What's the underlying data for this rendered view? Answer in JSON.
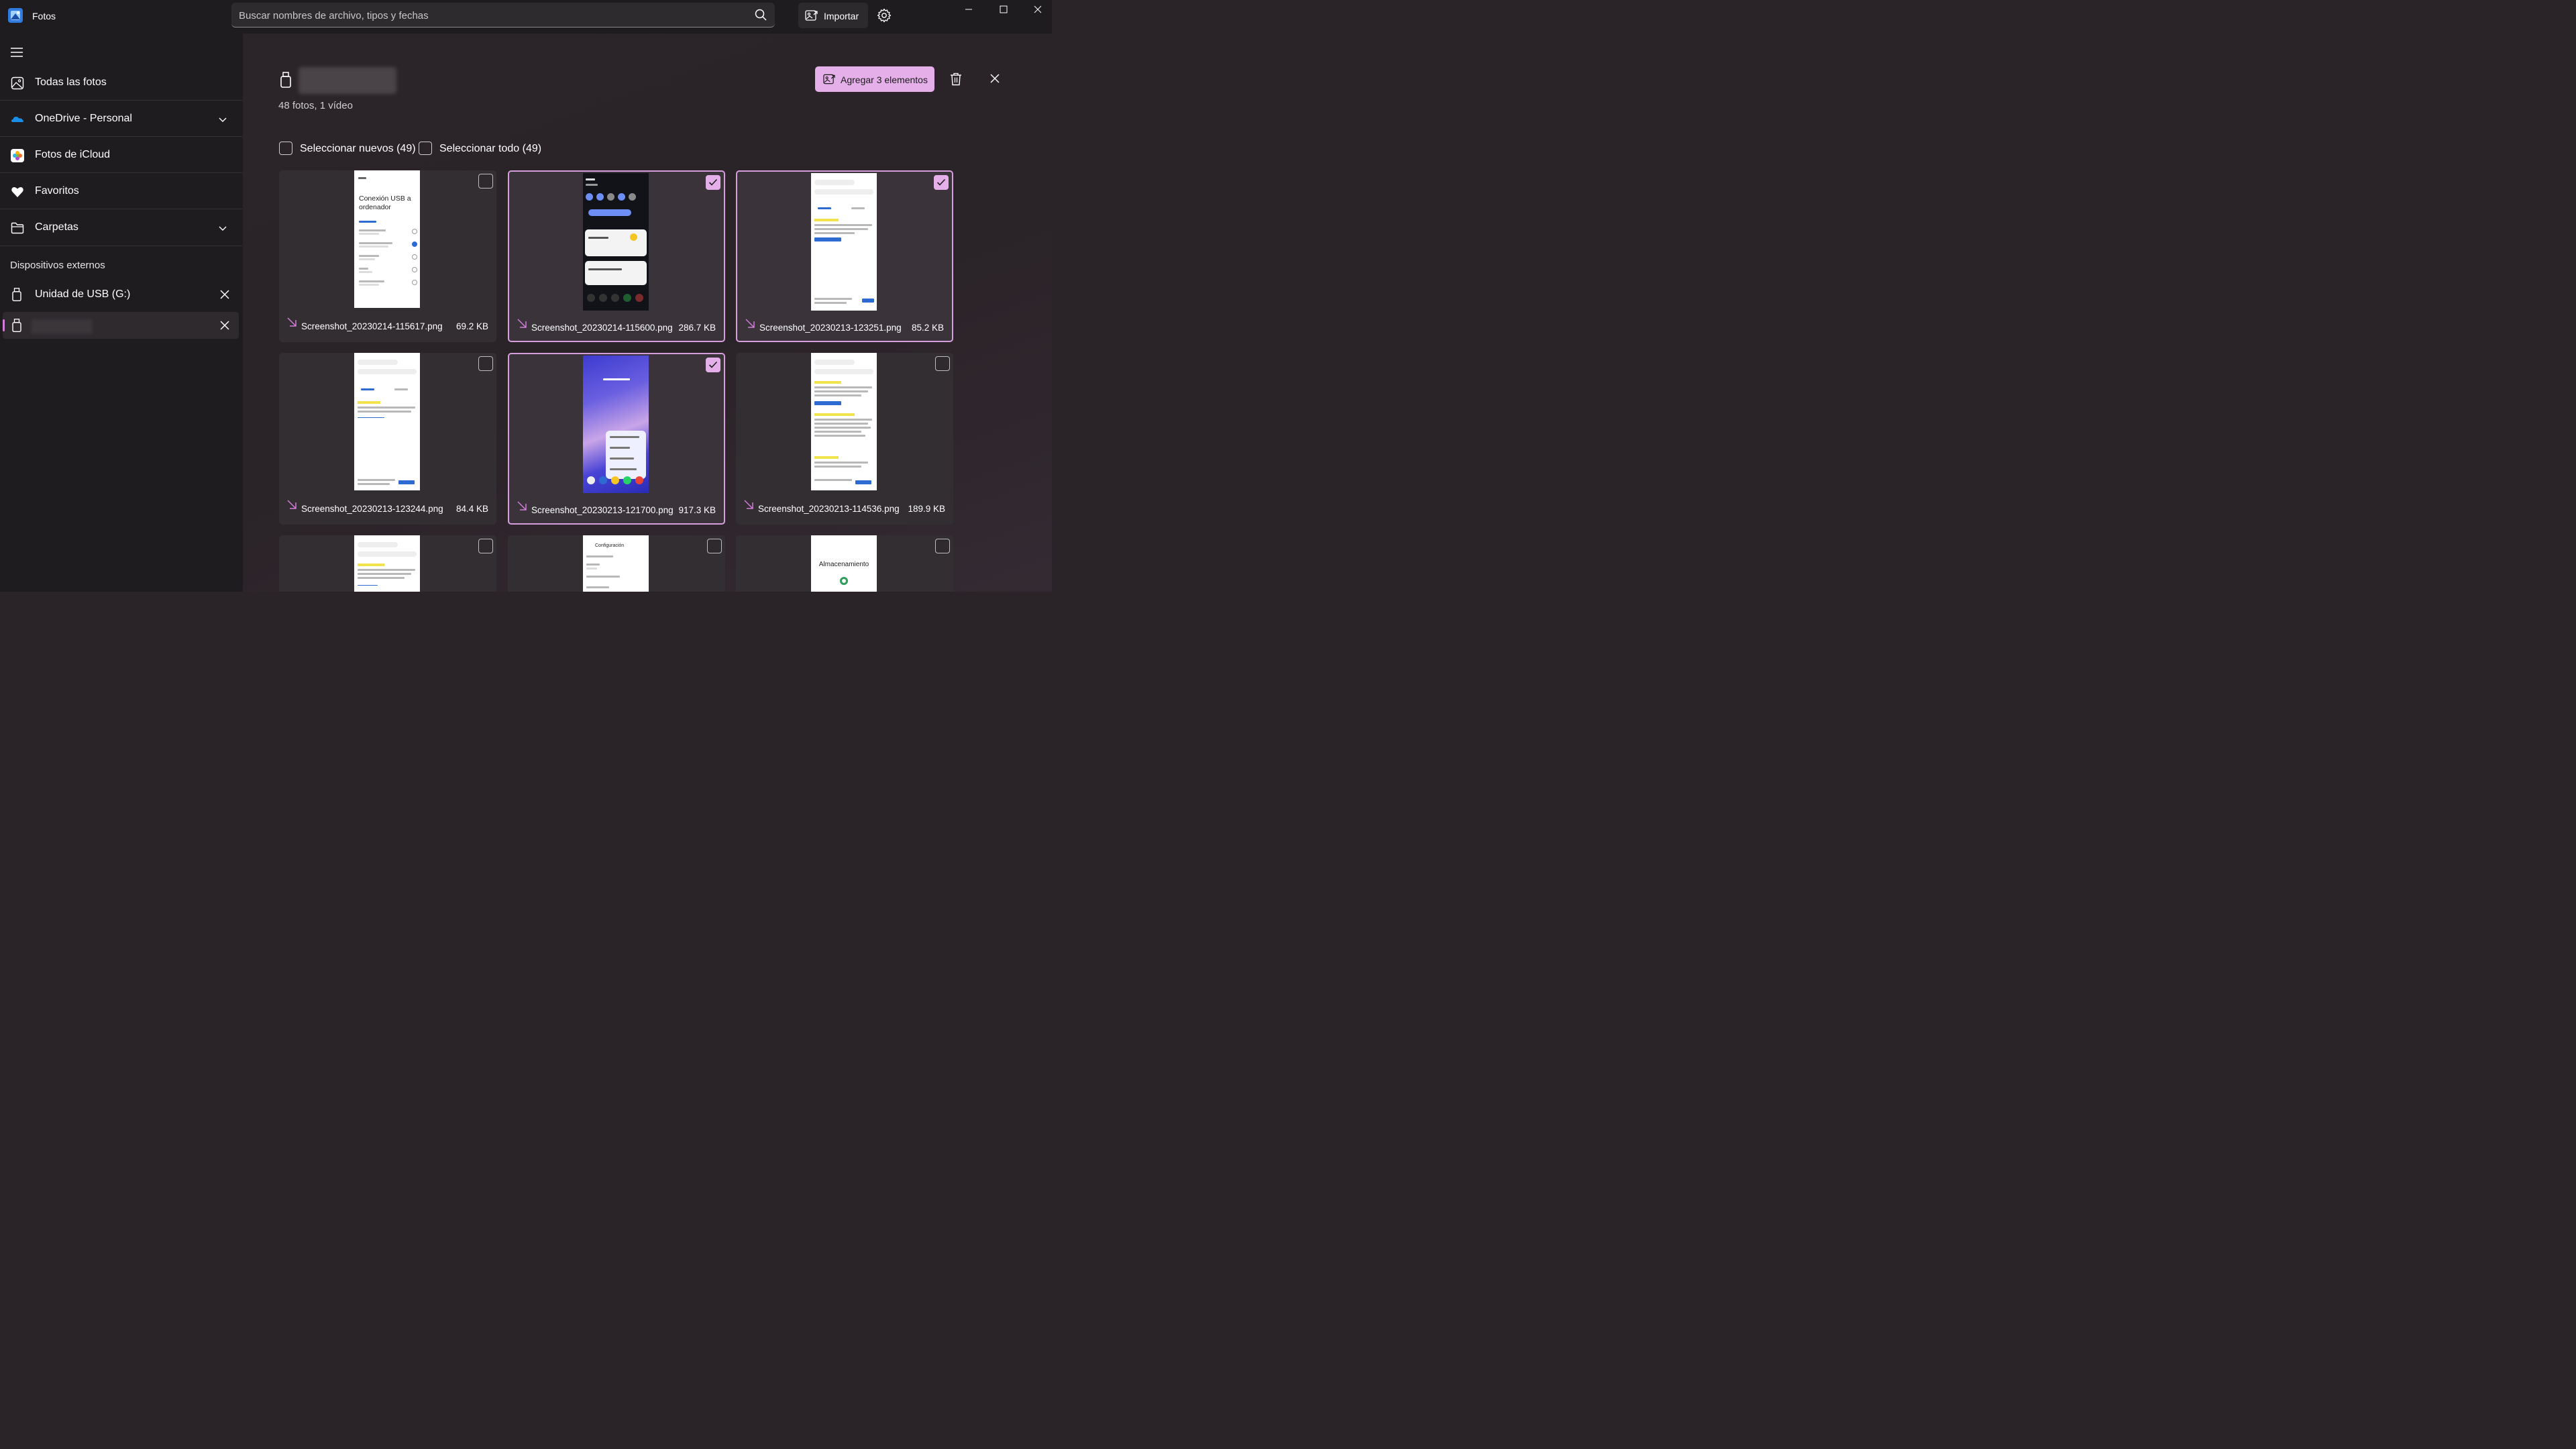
{
  "app": {
    "title": "Fotos"
  },
  "search": {
    "placeholder": "Buscar nombres de archivo, tipos y fechas"
  },
  "toolbar": {
    "import_label": "Importar"
  },
  "sidebar": {
    "items": [
      {
        "label": "Todas las fotos",
        "icon": "photos-icon"
      },
      {
        "label": "OneDrive - Personal",
        "icon": "onedrive-icon"
      },
      {
        "label": "Fotos de iCloud",
        "icon": "icloud-photos-icon"
      },
      {
        "label": "Favoritos",
        "icon": "heart-icon"
      },
      {
        "label": "Carpetas",
        "icon": "folder-icon"
      }
    ],
    "section_title": "Dispositivos externos",
    "devices": [
      {
        "label": "Unidad de USB (G:)",
        "icon": "usb-drive-icon"
      }
    ]
  },
  "main": {
    "summary": "48 fotos, 1 vídeo",
    "add_button": "Agregar 3 elementos",
    "select_new": "Seleccionar nuevos (49)",
    "select_all": "Seleccionar todo (49)",
    "accent_color": "#e5b0ea",
    "tiles": [
      {
        "name": "Screenshot_20230214-115617.png",
        "size": "69.2 KB",
        "selected": false
      },
      {
        "name": "Screenshot_20230214-115600.png",
        "size": "286.7 KB",
        "selected": true
      },
      {
        "name": "Screenshot_20230213-123251.png",
        "size": "85.2 KB",
        "selected": true
      },
      {
        "name": "Screenshot_20230213-123244.png",
        "size": "84.4 KB",
        "selected": false
      },
      {
        "name": "Screenshot_20230213-121700.png",
        "size": "917.3 KB",
        "selected": true
      },
      {
        "name": "Screenshot_20230213-114536.png",
        "size": "189.9 KB",
        "selected": false
      }
    ],
    "thumb_text": {
      "usb_title": "Conexión USB a ordenador",
      "storage_title": "Almacenamiento",
      "settings_title": "Configuración"
    }
  }
}
